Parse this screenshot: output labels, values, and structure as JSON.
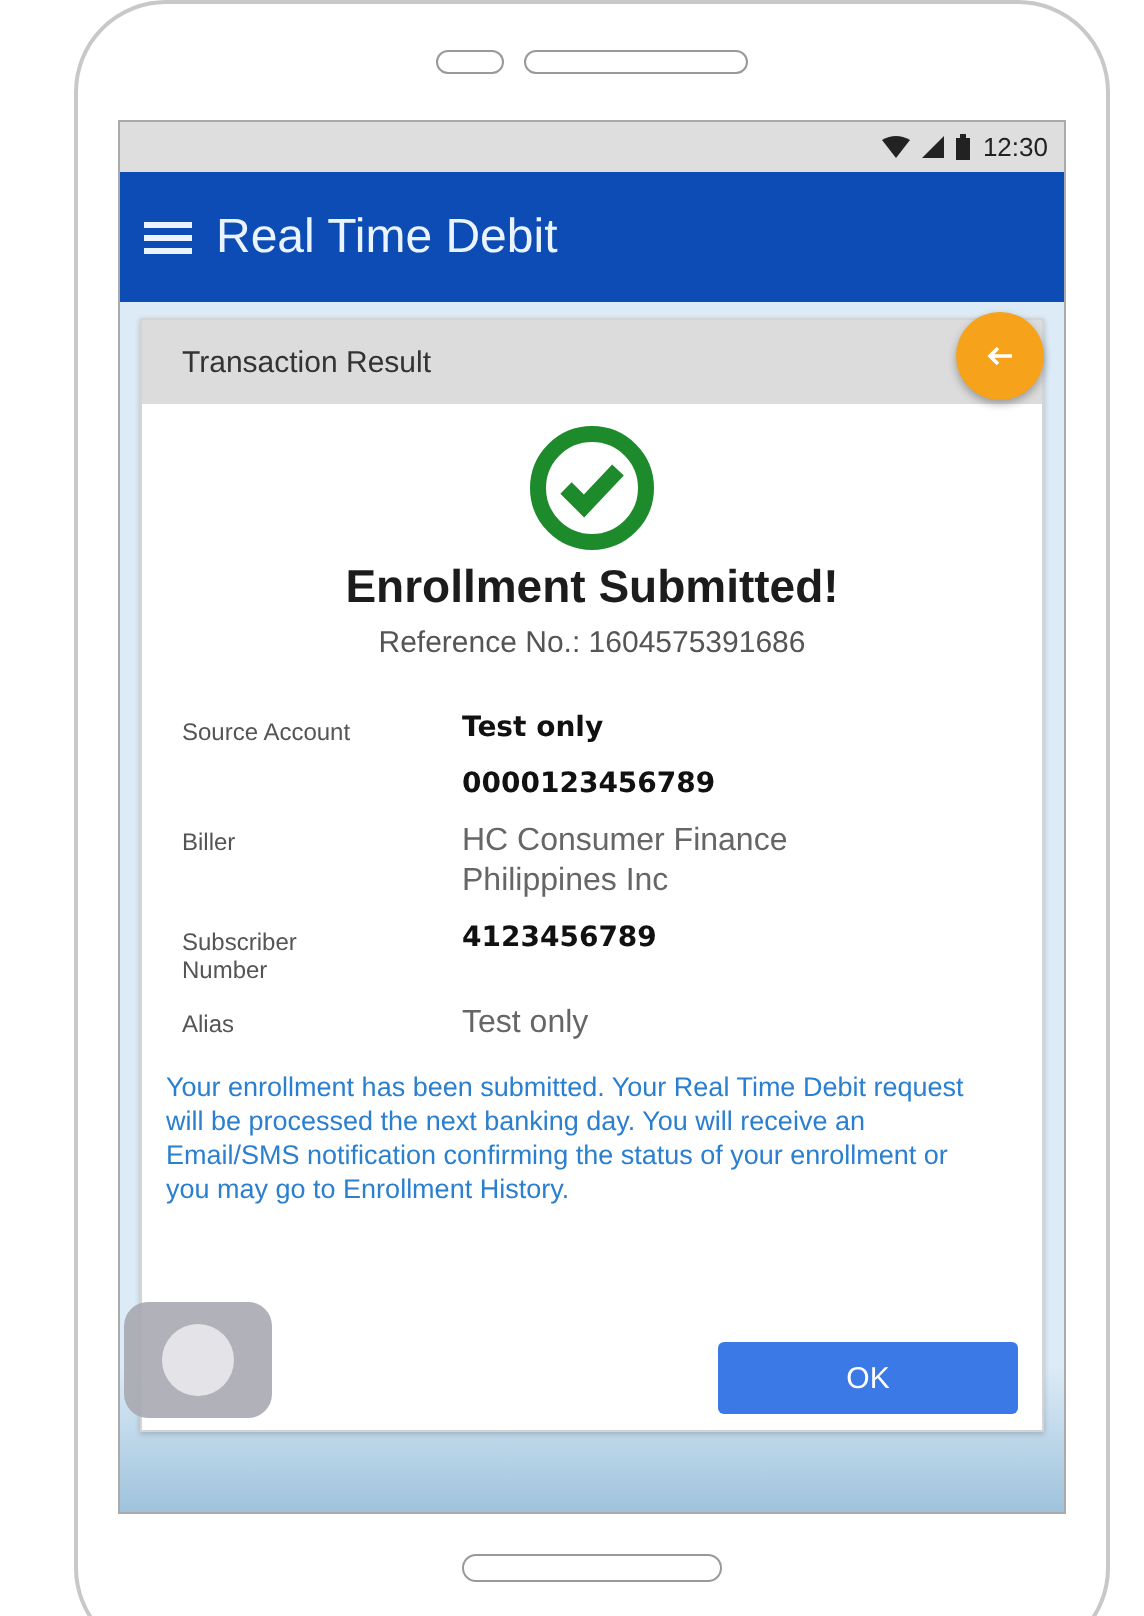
{
  "status_bar": {
    "time": "12:30"
  },
  "app_bar": {
    "title": "Real Time Debit"
  },
  "card": {
    "title": "Transaction Result",
    "heading": "Enrollment Submitted!",
    "reference": "Reference No.: 1604575391686",
    "details": [
      {
        "label": "Source Account",
        "values": [
          {
            "text": "Test only",
            "bold": true
          },
          {
            "text": "0000123456789",
            "bold": true
          }
        ]
      },
      {
        "label": "Biller",
        "values": [
          {
            "text": "HC Consumer Finance Philippines Inc",
            "bold": false
          }
        ]
      },
      {
        "label": "Subscriber Number",
        "values": [
          {
            "text": "4123456789",
            "bold": true
          }
        ]
      },
      {
        "label": "Alias",
        "values": [
          {
            "text": "Test only",
            "bold": false
          }
        ]
      }
    ],
    "message": "Your enrollment has been submitted. Your Real Time Debit request will be processed the next banking day. You will receive an Email/SMS notification confirming the status of your enrollment or you may go to Enrollment History.",
    "button": "OK"
  }
}
